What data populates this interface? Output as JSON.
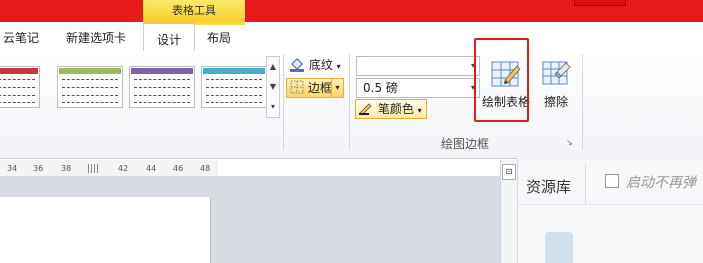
{
  "context_tab": {
    "label": "表格工具"
  },
  "tabs": [
    {
      "label": "云笔记"
    },
    {
      "label": "新建选项卡"
    },
    {
      "label": "设计"
    },
    {
      "label": "布局"
    }
  ],
  "styles_gallery": {
    "swatches": [
      {
        "color": "#c0393b"
      },
      {
        "color": "#9bbb59"
      },
      {
        "color": "#8064a2"
      },
      {
        "color": "#4bacc6"
      }
    ]
  },
  "shading": {
    "label": "底纹"
  },
  "borders": {
    "label": "边框"
  },
  "pen_style": {
    "value": ""
  },
  "pen_weight": {
    "value": "0.5 磅"
  },
  "pen_color": {
    "label": "笔颜色"
  },
  "draw_table": {
    "label": "绘制表格"
  },
  "eraser": {
    "label": "擦除"
  },
  "group": {
    "label": "绘图边框"
  },
  "ruler": {
    "ticks": [
      "34",
      "36",
      "38",
      "42",
      "44",
      "46",
      "48"
    ]
  },
  "resource_panel": {
    "title": "资源库",
    "checkbox_label": "启动不再弹"
  },
  "colors": {
    "title_bar": "#e8191b",
    "context_band": "#f6cf2c",
    "highlight_box": "#e21b1b"
  }
}
